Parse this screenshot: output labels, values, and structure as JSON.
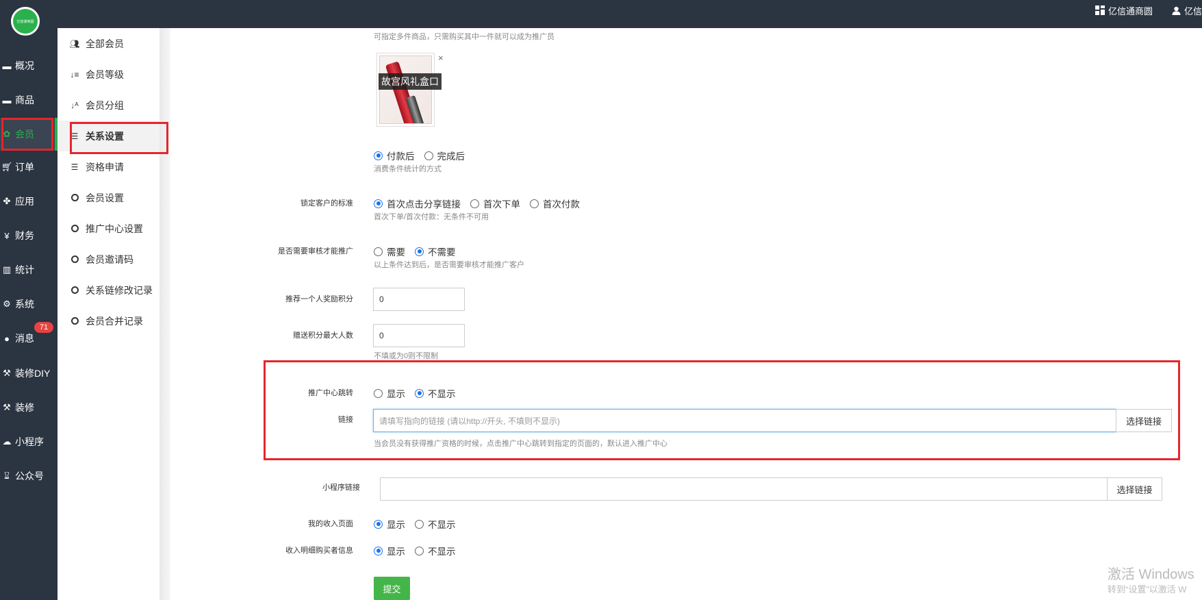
{
  "topbar": {
    "shop_name": "亿信通商圆",
    "user_name": "亿信"
  },
  "logo": {
    "text": "亿信通商圆"
  },
  "sidebar": {
    "items": [
      {
        "label": "概况",
        "icon": "dashboard-icon"
      },
      {
        "label": "商品",
        "icon": "box-icon"
      },
      {
        "label": "会员",
        "icon": "members-icon"
      },
      {
        "label": "订单",
        "icon": "cart-icon"
      },
      {
        "label": "应用",
        "icon": "apps-icon"
      },
      {
        "label": "财务",
        "icon": "yen-icon"
      },
      {
        "label": "统计",
        "icon": "bar-chart-icon"
      },
      {
        "label": "系统",
        "icon": "gears-icon"
      },
      {
        "label": "消息",
        "icon": "chat-icon"
      },
      {
        "label": "装修DIY",
        "icon": "hammer-icon"
      },
      {
        "label": "装修",
        "icon": "hammer-icon"
      },
      {
        "label": "小程序",
        "icon": "wechat-icon"
      },
      {
        "label": "公众号",
        "icon": "hourglass-icon"
      }
    ],
    "active": "会员",
    "message_badge": "71"
  },
  "subnav": {
    "items": [
      {
        "label": "全部会员",
        "icon": "users-icon"
      },
      {
        "label": "会员等级",
        "icon": "sort-level-icon"
      },
      {
        "label": "会员分组",
        "icon": "sort-az-icon"
      },
      {
        "label": "关系设置",
        "icon": "sliders-icon"
      },
      {
        "label": "资格申请",
        "icon": "sliders-icon"
      },
      {
        "label": "会员设置",
        "icon": "circle-icon"
      },
      {
        "label": "推广中心设置",
        "icon": "circle-icon"
      },
      {
        "label": "会员邀请码",
        "icon": "circle-icon"
      },
      {
        "label": "关系链修改记录",
        "icon": "circle-icon"
      },
      {
        "label": "会员合并记录",
        "icon": "circle-icon"
      }
    ],
    "active": "关系设置"
  },
  "form": {
    "top_hint": "可指定多件商品，只需购买其中一件就可以成为推广员",
    "product": {
      "caption": "故宫风礼盒口",
      "close": "×"
    },
    "pay_timing": {
      "options": [
        "付款后",
        "完成后"
      ],
      "selected": "付款后",
      "hint": "消费条件统计的方式"
    },
    "lock_standard": {
      "label": "锁定客户的标准",
      "options": [
        "首次点击分享链接",
        "首次下单",
        "首次付款"
      ],
      "selected": "首次点击分享链接",
      "hint": "首次下单/首次付款：无条件不可用"
    },
    "need_review": {
      "label": "是否需要审核才能推广",
      "options": [
        "需要",
        "不需要"
      ],
      "selected": "不需要",
      "hint": "以上条件达到后，是否需要审核才能推广客户"
    },
    "reward_points": {
      "label": "推荐一个人奖励积分",
      "value": "0"
    },
    "max_people": {
      "label": "赠送积分最大人数",
      "value": "0",
      "hint": "不填或为0则不限制"
    },
    "center_jump": {
      "label": "推广中心跳转",
      "options": [
        "显示",
        "不显示"
      ],
      "selected": "不显示"
    },
    "link": {
      "label": "链接",
      "placeholder": "请填写指向的链接 (请以http://开头, 不填则不显示)",
      "button": "选择链接",
      "hint": "当会员没有获得推广资格的时候，点击推广中心跳转到指定的页面的，默认进入推广中心"
    },
    "miniapp_link": {
      "label": "小程序链接",
      "value": "",
      "button": "选择链接"
    },
    "income_page": {
      "label": "我的收入页面",
      "options": [
        "显示",
        "不显示"
      ],
      "selected": "显示"
    },
    "buyer_info": {
      "label": "收入明细购买者信息",
      "options": [
        "显示",
        "不显示"
      ],
      "selected": "显示"
    },
    "submit": "提交"
  },
  "watermark": {
    "line1": "激活 Windows",
    "line2": "转到“设置”以激活 W"
  }
}
